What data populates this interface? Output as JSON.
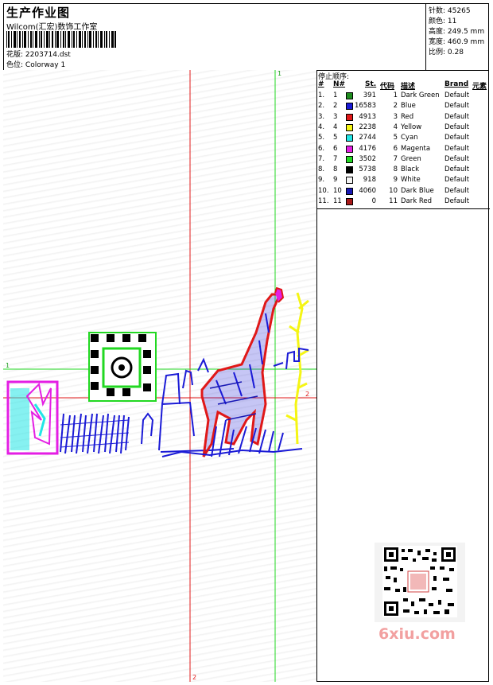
{
  "header": {
    "title": "生产作业图",
    "company": "Wilcom(汇宏)数饰工作室",
    "design_label": "花版:",
    "design_value": "2203714.dst",
    "color_label": "色位:",
    "color_value": "Colorway 1"
  },
  "stats": [
    {
      "label": "针数:",
      "value": "45265"
    },
    {
      "label": "颜色:",
      "value": "11"
    },
    {
      "label": "高度:",
      "value": "249.5 mm"
    },
    {
      "label": "宽度:",
      "value": "460.9 mm"
    },
    {
      "label": "比例:",
      "value": "0.28"
    }
  ],
  "stop_table": {
    "title": "停止顺序:",
    "headers": {
      "num": "#",
      "n": "N#",
      "st": "St.",
      "code": "代码",
      "desc": "描述",
      "brand": "Brand",
      "element": "元素"
    },
    "rows": [
      {
        "num": "1.",
        "n": "1",
        "st": "391",
        "code": "1",
        "desc": "Dark Green",
        "brand": "Default",
        "color": "#1e8c1e"
      },
      {
        "num": "2.",
        "n": "2",
        "st": "16583",
        "code": "2",
        "desc": "Blue",
        "brand": "Default",
        "color": "#1a1ad6"
      },
      {
        "num": "3.",
        "n": "3",
        "st": "4913",
        "code": "3",
        "desc": "Red",
        "brand": "Default",
        "color": "#e01818"
      },
      {
        "num": "4.",
        "n": "4",
        "st": "2238",
        "code": "4",
        "desc": "Yellow",
        "brand": "Default",
        "color": "#f5f514"
      },
      {
        "num": "5.",
        "n": "5",
        "st": "2744",
        "code": "5",
        "desc": "Cyan",
        "brand": "Default",
        "color": "#22e6e6"
      },
      {
        "num": "6.",
        "n": "6",
        "st": "4176",
        "code": "6",
        "desc": "Magenta",
        "brand": "Default",
        "color": "#e41ee4"
      },
      {
        "num": "7.",
        "n": "7",
        "st": "3502",
        "code": "7",
        "desc": "Green",
        "brand": "Default",
        "color": "#22d822"
      },
      {
        "num": "8.",
        "n": "8",
        "st": "5738",
        "code": "8",
        "desc": "Black",
        "brand": "Default",
        "color": "#000000"
      },
      {
        "num": "9.",
        "n": "9",
        "st": "918",
        "code": "9",
        "desc": "White",
        "brand": "Default",
        "color": "#f4f4f4"
      },
      {
        "num": "10.",
        "n": "10",
        "st": "4060",
        "code": "10",
        "desc": "Dark Blue",
        "brand": "Default",
        "color": "#1818b4"
      },
      {
        "num": "11.",
        "n": "11",
        "st": "0",
        "code": "11",
        "desc": "Dark Red",
        "brand": "Default",
        "color": "#a81818"
      }
    ]
  },
  "markers": {
    "v1": "1",
    "h1": "1",
    "h2": "2",
    "v2": "2"
  },
  "watermark": "6xiu.com"
}
